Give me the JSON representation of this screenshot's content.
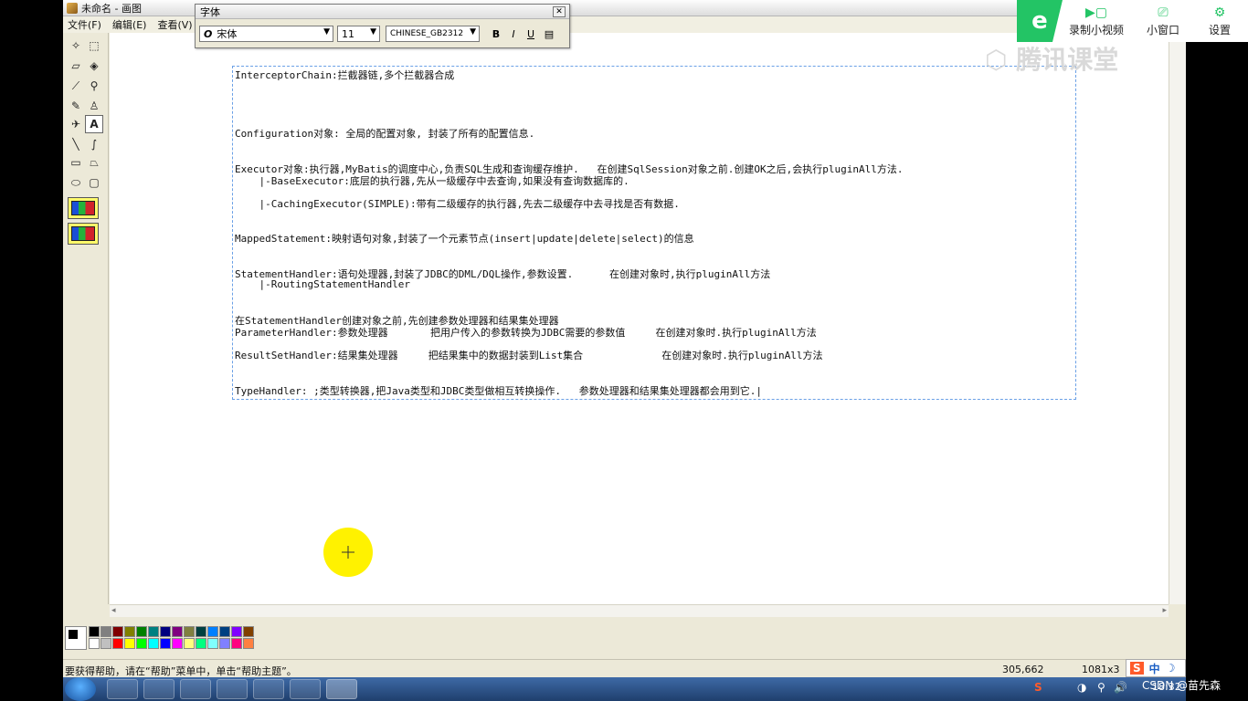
{
  "window": {
    "title": "未命名 - 画图"
  },
  "menu": {
    "items": [
      "文件(F)",
      "编辑(E)",
      "查看(V)"
    ]
  },
  "font_toolbar": {
    "title": "字体",
    "font_name": "宋体",
    "font_size": "11",
    "charset": "CHINESE_GB2312",
    "bold": "B",
    "italic": "I",
    "underline": "U"
  },
  "document": {
    "lines": [
      "InterceptorChain:拦截器链,多个拦截器合成",
      "Configuration对象: 全局的配置对象, 封装了所有的配置信息.",
      "Executor对象:执行器,MyBatis的调度中心,负责SQL生成和查询缓存维护.   在创建SqlSession对象之前.创建OK之后,会执行pluginAll方法.",
      "    |-BaseExecutor:底层的执行器,先从一级缓存中去查询,如果没有查询数据库的.",
      "    |-CachingExecutor(SIMPLE):带有二级缓存的执行器,先去二级缓存中去寻找是否有数据.",
      "MappedStatement:映射语句对象,封装了一个元素节点(insert|update|delete|select)的信息",
      "StatementHandler:语句处理器,封装了JDBC的DML/DQL操作,参数设置.      在创建对象时,执行pluginAll方法",
      "    |-RoutingStatementHandler",
      "在StatementHandler创建对象之前,先创建参数处理器和结果集处理器",
      "ParameterHandler:参数处理器       把用户传入的参数转换为JDBC需要的参数值     在创建对象时.执行pluginAll方法",
      "ResultSetHandler:结果集处理器     把结果集中的数据封装到List集合             在创建对象时.执行pluginAll方法",
      "TypeHandler: ;类型转换器,把Java类型和JDBC类型做相互转换操作.   参数处理器和结果集处理器都会用到它.|"
    ]
  },
  "status": {
    "help": "要获得帮助，请在“帮助”菜单中，单击“帮助主题”。",
    "coords": "305,662",
    "size": "1081x3"
  },
  "tencent": {
    "logo": "e",
    "record_label": "录制小视频",
    "mini_label": "小窗口",
    "settings_label": "设置",
    "watermark": "腾讯课堂"
  },
  "taskbar": {
    "clock": "18:32",
    "ime_lang": "中",
    "ime_logo": "S"
  },
  "csdn": {
    "label": "CSDN @苗先森"
  },
  "colors": {
    "palette": [
      "#000000",
      "#808080",
      "#800000",
      "#808000",
      "#008000",
      "#008080",
      "#000080",
      "#800080",
      "#808040",
      "#004040",
      "#0080ff",
      "#004080",
      "#8000ff",
      "#804000",
      "#ffffff",
      "#c0c0c0",
      "#ff0000",
      "#ffff00",
      "#00ff00",
      "#00ffff",
      "#0000ff",
      "#ff00ff",
      "#ffff80",
      "#00ff80",
      "#80ffff",
      "#8080ff",
      "#ff0080",
      "#ff8040"
    ],
    "accent": "#23c465"
  }
}
